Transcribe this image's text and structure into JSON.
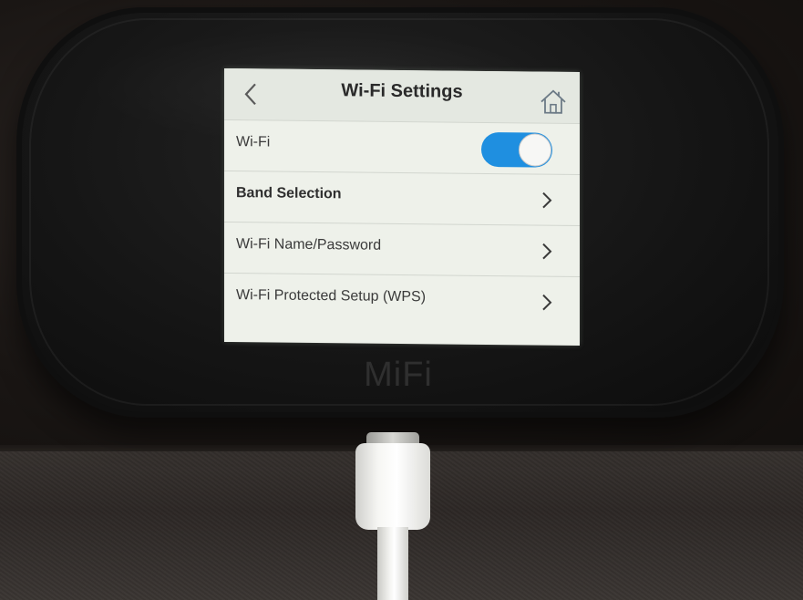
{
  "device": {
    "brand": "MiFi"
  },
  "screen": {
    "title": "Wi-Fi Settings",
    "back_icon": "chevron-left-icon",
    "home_icon": "home-icon",
    "rows": [
      {
        "label": "Wi-Fi",
        "control": "toggle",
        "toggle_on": true
      },
      {
        "label": "Band Selection",
        "control": "chevron-right-icon"
      },
      {
        "label": "Wi-Fi Name/Password",
        "control": "chevron-right-icon"
      },
      {
        "label": "Wi-Fi Protected Setup (WPS)",
        "control": "chevron-right-icon"
      }
    ]
  },
  "colors": {
    "toggle_on": "#1f8fe0",
    "screen_background": "#eef1ea",
    "device_body": "#151515"
  }
}
